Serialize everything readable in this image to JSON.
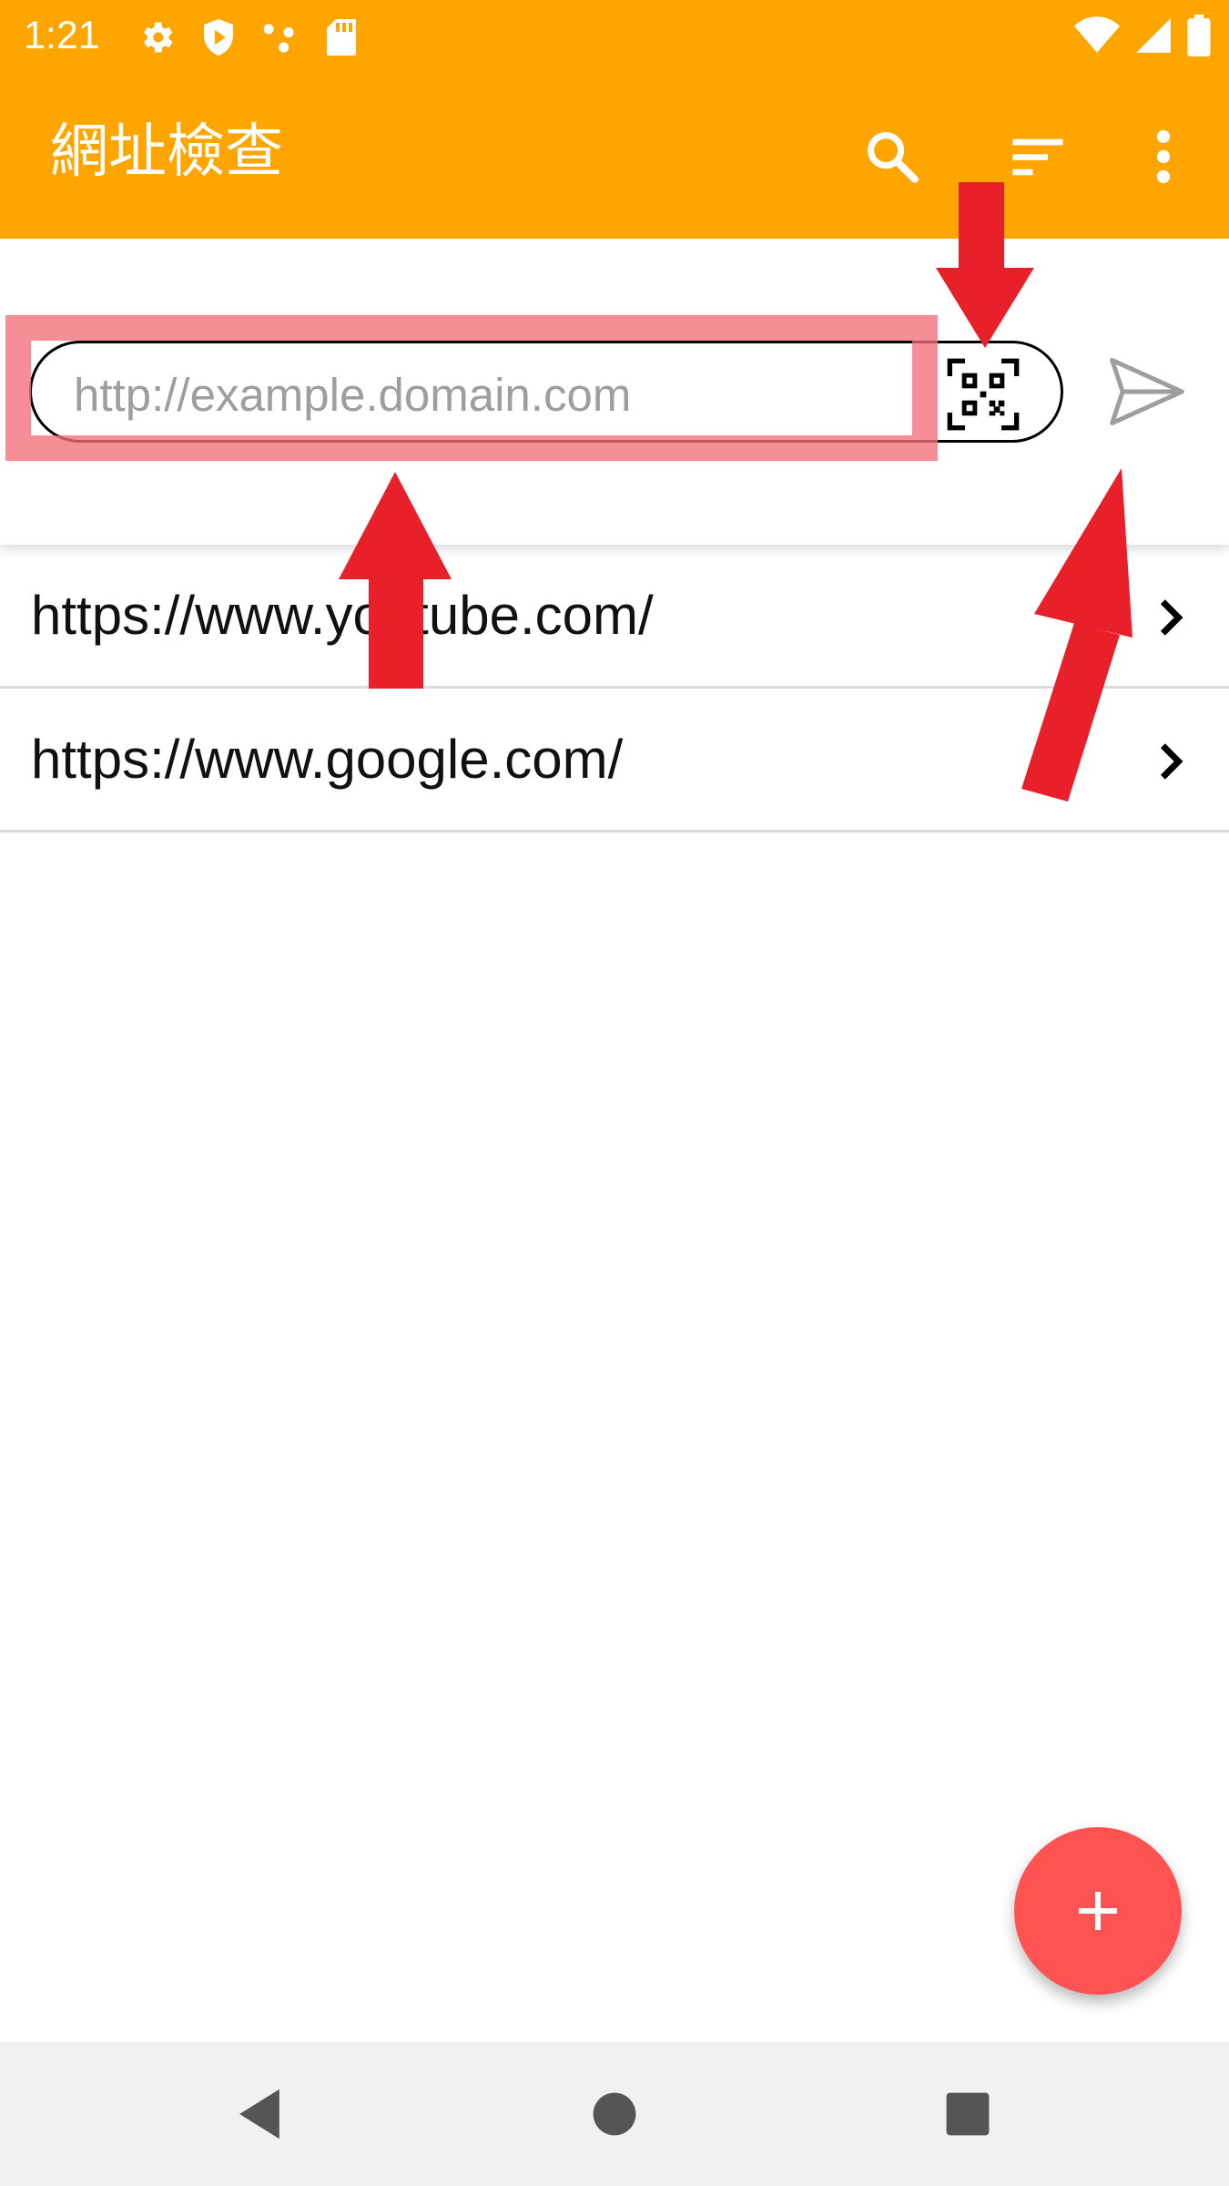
{
  "status_bar": {
    "time": "1:21",
    "icons_left": [
      "settings-icon",
      "shield-play-icon",
      "dots-icon",
      "sd-card-icon"
    ],
    "icons_right": [
      "wifi-icon",
      "signal-icon",
      "battery-icon"
    ]
  },
  "app_bar": {
    "title": "網址檢查",
    "background": "#FFA500",
    "actions": [
      "search-icon",
      "sort-icon",
      "more-vert-icon"
    ]
  },
  "url_input": {
    "placeholder": "http://example.domain.com",
    "value": ""
  },
  "history": [
    {
      "url": "https://www.youtube.com/"
    },
    {
      "url": "https://www.google.com/"
    }
  ],
  "annotation": {
    "highlight_color": "#F46E78",
    "arrow_color": "#E8202A"
  },
  "fab": {
    "icon": "plus-icon",
    "color": "#FF5252"
  },
  "nav_bar": [
    "back-icon",
    "home-icon",
    "recents-icon"
  ]
}
